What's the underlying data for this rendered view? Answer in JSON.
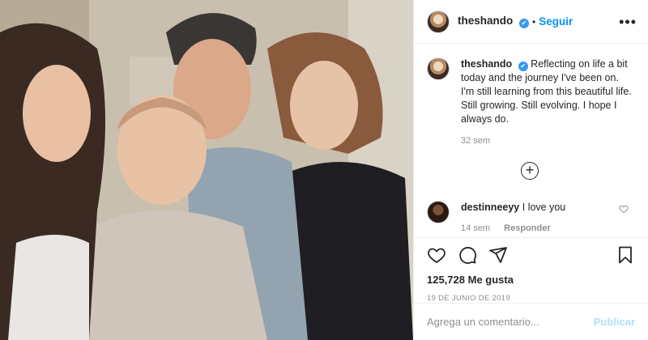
{
  "post": {
    "username": "theshando",
    "verified_badge": "✔",
    "separator": "•",
    "follow_label": "Seguir",
    "more_label": "•••"
  },
  "caption": {
    "username": "theshando",
    "text": "Reflecting on life a bit today and the journey I've been on. I'm still learning from this beautiful life. Still growing. Still evolving. I hope I always do.",
    "time_ago": "32 sem"
  },
  "load_more_label": "+",
  "comment": {
    "username": "destinneeyy",
    "text": "I love you",
    "time_ago": "14 sem",
    "reply_label": "Responder"
  },
  "likes": {
    "count": "125,728",
    "label": "Me gusta"
  },
  "date": "19 DE JUNIO DE 2019",
  "add_comment": {
    "placeholder": "Agrega un comentario...",
    "publish_label": "Publicar"
  },
  "colors": {
    "link_blue": "#0095f6",
    "verified_blue": "#3897f0",
    "publish_disabled": "#b2dffc",
    "muted_text": "#8e8e8e"
  },
  "icons": [
    "heart-icon",
    "comment-icon",
    "share-icon",
    "bookmark-icon",
    "plus-circle-icon",
    "small-heart-icon",
    "verified-icon",
    "more-options-icon"
  ]
}
